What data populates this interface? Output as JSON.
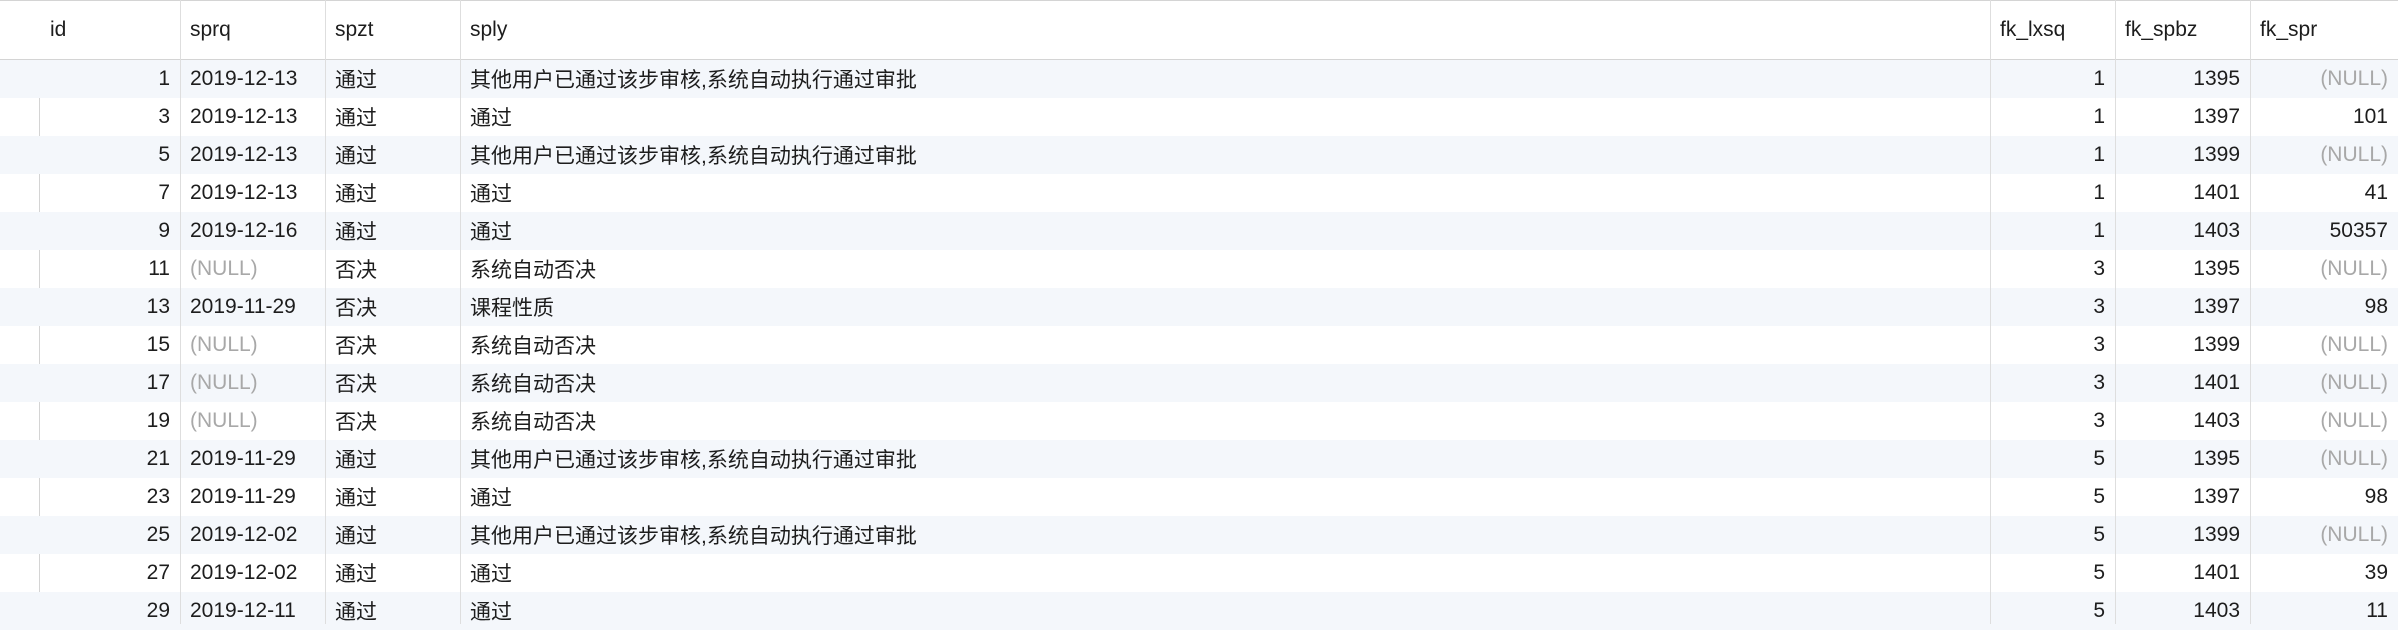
{
  "columns": [
    "id",
    "sprq",
    "spzt",
    "sply",
    "fk_lxsq",
    "fk_spbz",
    "fk_spr"
  ],
  "rows": [
    [
      "1",
      "2019-12-13",
      "通过",
      "其他用户已通过该步审核,系统自动执行通过审批",
      "1",
      "1395",
      "(NULL)"
    ],
    [
      "3",
      "2019-12-13",
      "通过",
      "通过",
      "1",
      "1397",
      "101"
    ],
    [
      "5",
      "2019-12-13",
      "通过",
      "其他用户已通过该步审核,系统自动执行通过审批",
      "1",
      "1399",
      "(NULL)"
    ],
    [
      "7",
      "2019-12-13",
      "通过",
      "通过",
      "1",
      "1401",
      "41"
    ],
    [
      "9",
      "2019-12-16",
      "通过",
      "通过",
      "1",
      "1403",
      "50357"
    ],
    [
      "11",
      "(NULL)",
      "否决",
      "系统自动否决",
      "3",
      "1395",
      "(NULL)"
    ],
    [
      "13",
      "2019-11-29",
      "否决",
      "课程性质",
      "3",
      "1397",
      "98"
    ],
    [
      "15",
      "(NULL)",
      "否决",
      "系统自动否决",
      "3",
      "1399",
      "(NULL)"
    ],
    [
      "17",
      "(NULL)",
      "否决",
      "系统自动否决",
      "3",
      "1401",
      "(NULL)"
    ],
    [
      "19",
      "(NULL)",
      "否决",
      "系统自动否决",
      "3",
      "1403",
      "(NULL)"
    ],
    [
      "21",
      "2019-11-29",
      "通过",
      "其他用户已通过该步审核,系统自动执行通过审批",
      "5",
      "1395",
      "(NULL)"
    ],
    [
      "23",
      "2019-11-29",
      "通过",
      "通过",
      "5",
      "1397",
      "98"
    ],
    [
      "25",
      "2019-12-02",
      "通过",
      "其他用户已通过该步审核,系统自动执行通过审批",
      "5",
      "1399",
      "(NULL)"
    ],
    [
      "27",
      "2019-12-02",
      "通过",
      "通过",
      "5",
      "1401",
      "39"
    ],
    [
      "29",
      "2019-12-11",
      "通过",
      "通过",
      "5",
      "1403",
      "11"
    ]
  ]
}
